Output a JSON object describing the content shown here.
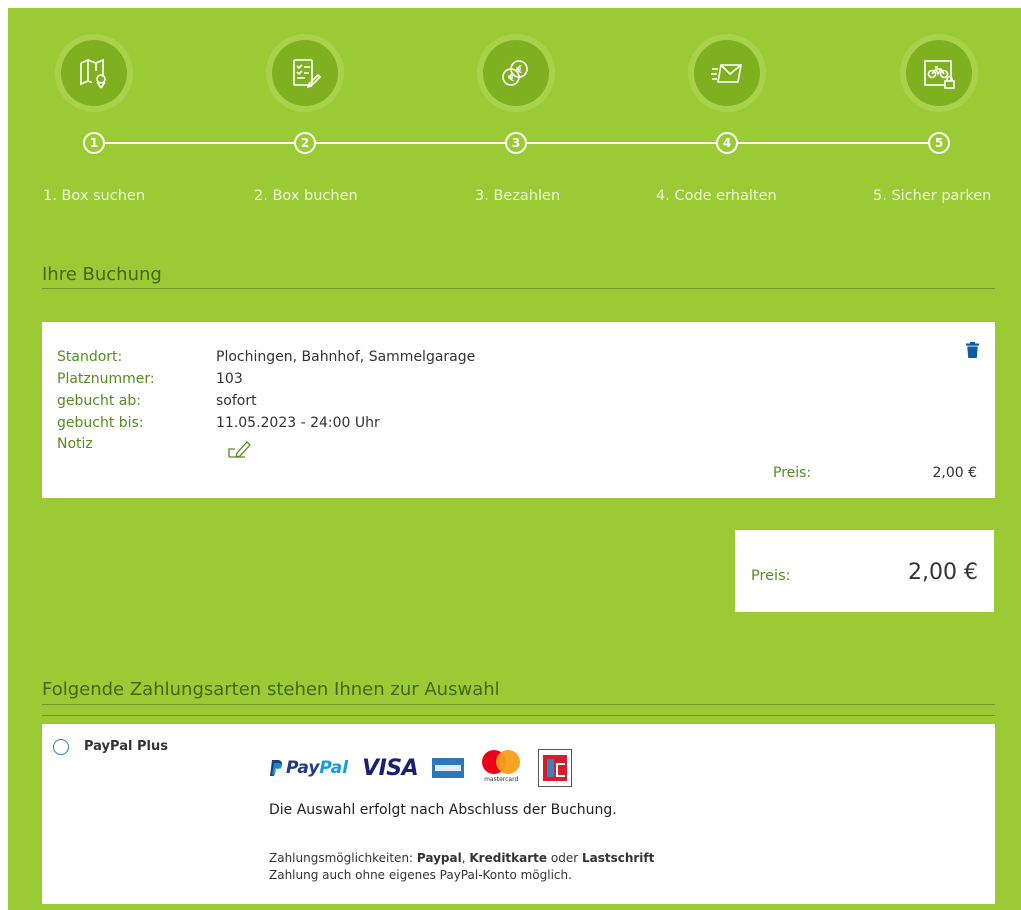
{
  "steps": [
    {
      "num": "1",
      "label": "1. Box suchen",
      "icon": "map-pin-icon"
    },
    {
      "num": "2",
      "label": "2. Box buchen",
      "icon": "checklist-pen-icon"
    },
    {
      "num": "3",
      "label": "3. Bezahlen",
      "icon": "euro-coins-icon"
    },
    {
      "num": "4",
      "label": "4. Code erhalten",
      "icon": "mail-icon"
    },
    {
      "num": "5",
      "label": "5. Sicher parken",
      "icon": "bike-lock-icon"
    }
  ],
  "booking": {
    "title": "Ihre Buchung",
    "rows": [
      {
        "label": "Standort:",
        "value": "Plochingen, Bahnhof, Sammelgarage"
      },
      {
        "label": "Platznummer:",
        "value": "103"
      },
      {
        "label": "gebucht ab:",
        "value": "sofort"
      },
      {
        "label": "gebucht bis:",
        "value": "11.05.2023 - 24:00 Uhr"
      },
      {
        "label": "Notiz",
        "value": ""
      }
    ],
    "price_label": "Preis:",
    "price_value": "2,00 €"
  },
  "total": {
    "label": "Preis:",
    "value": "2,00 €"
  },
  "payment": {
    "title": "Folgende Zahlungsarten stehen Ihnen zur Auswahl",
    "option_name": "PayPal Plus",
    "logo_paypal": "PayPal",
    "logo_visa": "VISA",
    "logo_mastercard": "mastercard",
    "main_text": "Die Auswahl erfolgt nach Abschluss der Buchung.",
    "note_prefix": "Zahlungsmöglichkeiten: ",
    "note_paypal": "Paypal",
    "note_sep1": ", ",
    "note_kredit": "Kreditkarte",
    "note_sep2": " oder ",
    "note_last": "Lastschrift",
    "note_line2": "Zahlung auch ohne eigenes PayPal-Konto möglich."
  },
  "colors": {
    "background": "#9bcb34",
    "accent_text": "#558c1f",
    "radio": "#2e7dd1"
  }
}
